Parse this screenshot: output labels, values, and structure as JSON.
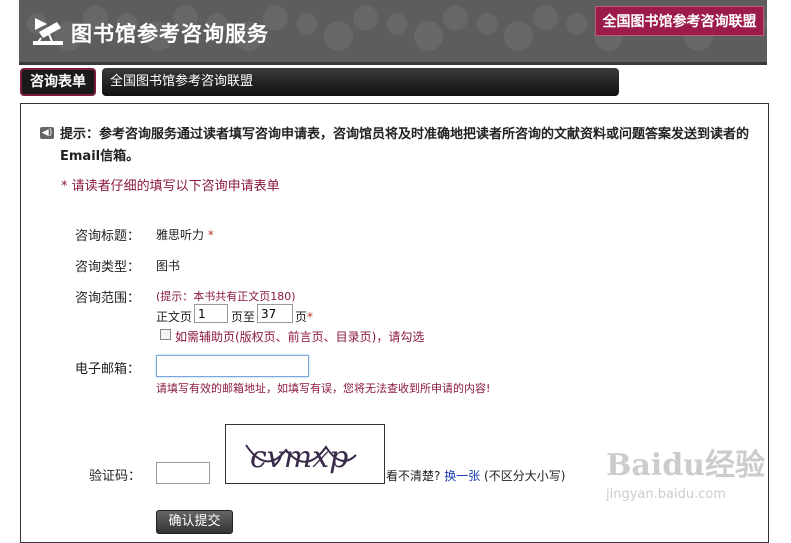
{
  "header": {
    "title": "图书馆参考咨询服务",
    "alliance_button": "全国图书馆参考咨询联盟"
  },
  "nav": {
    "tab_label": "咨询表单",
    "bar_text": "全国图书馆参考咨询联盟"
  },
  "tip": {
    "text": "提示：参考咨询服务通过读者填写咨询申请表，咨询馆员将及时准确地把读者所咨询的文献资料或问题答案发送到读者的Email信箱。"
  },
  "notice": "* 请读者仔细的填写以下咨询申请表单",
  "form": {
    "title_label": "咨询标题：",
    "title_value": "雅思听力",
    "title_required": "*",
    "type_label": "咨询类型：",
    "type_value": "图书",
    "range_label": "咨询范围：",
    "range_hint": "(提示：本书共有正文页180)",
    "range_prefix": "正文页",
    "range_from": "1",
    "range_to_text": "页至",
    "range_to": "37",
    "range_suffix": "页",
    "range_required": "*",
    "aux_pages_label": "如需辅助页(版权页、前言页、目录页)，请勾选",
    "email_label": "电子邮箱：",
    "email_value": "",
    "email_hint": "请填写有效的邮箱地址，如填写有误，您将无法查收到所申请的内容!",
    "captcha_label": "验证码：",
    "captcha_value": "",
    "captcha_image_text": "cvmxp",
    "captcha_unclear": "看不清楚?",
    "captcha_refresh": "换一张",
    "captcha_case_note": "(不区分大小写)",
    "submit_label": "确认提交"
  },
  "watermark": {
    "brand": "Baidu经验",
    "url": "jingyan.baidu.com"
  }
}
